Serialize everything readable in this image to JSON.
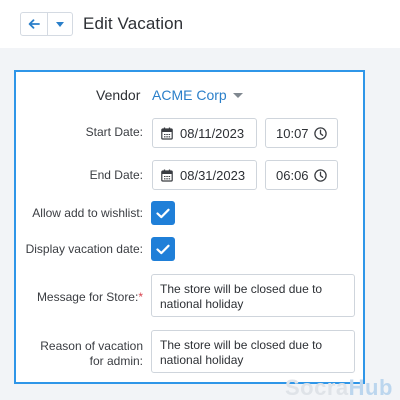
{
  "header": {
    "title": "Edit Vacation",
    "back_icon": "arrow-left-icon",
    "dropdown_icon": "caret-down-icon",
    "accent": "#2f96e8"
  },
  "form": {
    "vendor": {
      "label": "Vendor",
      "value": "ACME Corp"
    },
    "start_date": {
      "label": "Start Date:",
      "date": "08/11/2023",
      "time": "10:07"
    },
    "end_date": {
      "label": "End Date:",
      "date": "08/31/2023",
      "time": "06:06"
    },
    "allow_wishlist": {
      "label": "Allow add to wishlist:",
      "checked": true
    },
    "display_vacation_date": {
      "label": "Display vacation date:",
      "checked": true
    },
    "message_store": {
      "label": "Message for Store:",
      "required_mark": "*",
      "value": "The store will be closed due to national holiday"
    },
    "reason_admin": {
      "label_line1": "Reason of vacation",
      "label_line2": "for admin:",
      "value": "The store will be closed due to national holiday"
    }
  },
  "watermark": {
    "part1": "Socra",
    "part2": "Hub"
  },
  "colors": {
    "link": "#2a7fc9",
    "checkbox": "#1f7fd8",
    "required": "#d9434f"
  }
}
